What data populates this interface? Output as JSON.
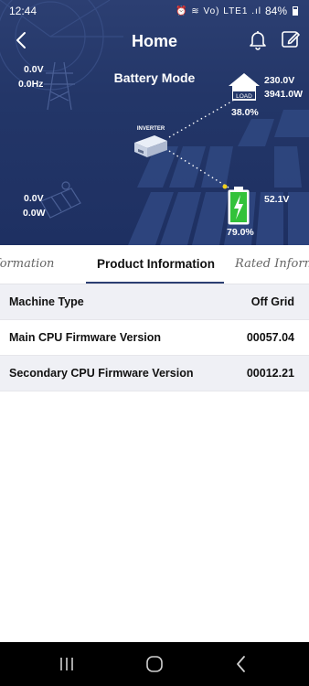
{
  "status_bar": {
    "time": "12:44",
    "icons": "⏰ ≋ Vo) LTE1 .ıl",
    "battery": "84%"
  },
  "header": {
    "title": "Home",
    "back_icon": "back-arrow-icon",
    "bell_icon": "bell-icon",
    "edit_icon": "edit-icon"
  },
  "energy_flow": {
    "mode": "Battery Mode",
    "grid": {
      "voltage": "0.0V",
      "frequency": "0.0Hz"
    },
    "load": {
      "voltage": "230.0V",
      "power": "3941.0W",
      "percent": "38.0%",
      "badge": "LOAD"
    },
    "solar": {
      "voltage": "0.0V",
      "power": "0.0W"
    },
    "battery": {
      "voltage": "52.1V",
      "percent": "79.0%"
    },
    "inverter_label": "INVERTER"
  },
  "tabs": [
    {
      "label": "c Information",
      "active": false
    },
    {
      "label": "Product Information",
      "active": true
    },
    {
      "label": "Rated Inform",
      "active": false
    }
  ],
  "rows": [
    {
      "label": "Machine Type",
      "value": "Off Grid"
    },
    {
      "label": "Main CPU Firmware Version",
      "value": "00057.04"
    },
    {
      "label": "Secondary CPU Firmware Version",
      "value": "00012.21"
    }
  ],
  "colors": {
    "hero_bg": "#233668",
    "accent": "#2c3f72",
    "battery_green": "#33c23a",
    "flow_dot": "#f2d21b"
  }
}
